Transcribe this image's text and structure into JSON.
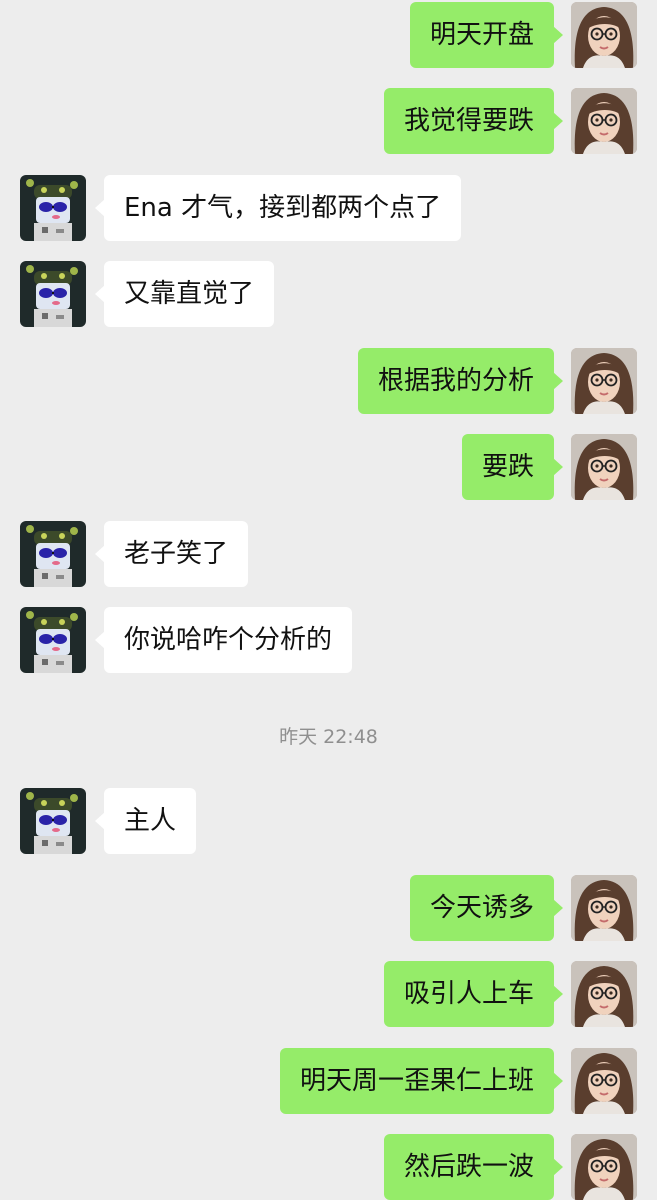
{
  "chat": {
    "messages": [
      {
        "side": "right",
        "text": "明天开盘"
      },
      {
        "side": "right",
        "text": "我觉得要跌"
      },
      {
        "side": "left",
        "text": "Ena 才气，接到都两个点了"
      },
      {
        "side": "left",
        "text": "又靠直觉了"
      },
      {
        "side": "right",
        "text": "根据我的分析"
      },
      {
        "side": "right",
        "text": "要跌"
      },
      {
        "side": "left",
        "text": "老子笑了"
      },
      {
        "side": "left",
        "text": "你说哈咋个分析的"
      },
      {
        "side": "left",
        "text": "主人"
      },
      {
        "side": "right",
        "text": "今天诱多"
      },
      {
        "side": "right",
        "text": "吸引人上车"
      },
      {
        "side": "right",
        "text": "明天周一歪果仁上班"
      },
      {
        "side": "right",
        "text": "然后跌一波"
      }
    ],
    "timestamp": "昨天 22:48"
  },
  "colors": {
    "background": "#ededed",
    "sent_bubble": "#95ec69",
    "received_bubble": "#ffffff",
    "timestamp_text": "#8f8f8f"
  },
  "icons": {
    "self_avatar": "woman-with-glasses-avatar",
    "friend_avatar": "cartoon-sunglasses-avatar"
  }
}
